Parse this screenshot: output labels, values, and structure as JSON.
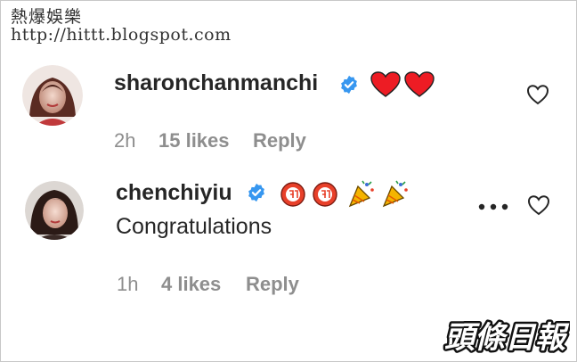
{
  "watermark": {
    "title": "熱爆娛樂",
    "url": "http://hittt.blogspot.com"
  },
  "comments": [
    {
      "username": "sharonchanmanchi",
      "verified": true,
      "emojis": [
        "heart-emoji",
        "heart-emoji"
      ],
      "text": "",
      "time": "2h",
      "likes": "15 likes",
      "reply": "Reply"
    },
    {
      "username": "chenchiyiu",
      "verified": true,
      "emojis": [
        "congratulations-emoji",
        "congratulations-emoji",
        "party-popper-emoji",
        "party-popper-emoji"
      ],
      "text": "Congratulations",
      "time": "1h",
      "likes": "4 likes",
      "reply": "Reply"
    }
  ],
  "colors": {
    "verified": "#3797f0",
    "heart_red": "#ed1c24",
    "muted": "#8e8e8e",
    "text": "#262626"
  },
  "icons": {
    "like": "heart-outline-icon",
    "more": "more-options-icon",
    "verified": "verified-badge-icon"
  },
  "brand_logo": {
    "text": "頭條日報"
  }
}
